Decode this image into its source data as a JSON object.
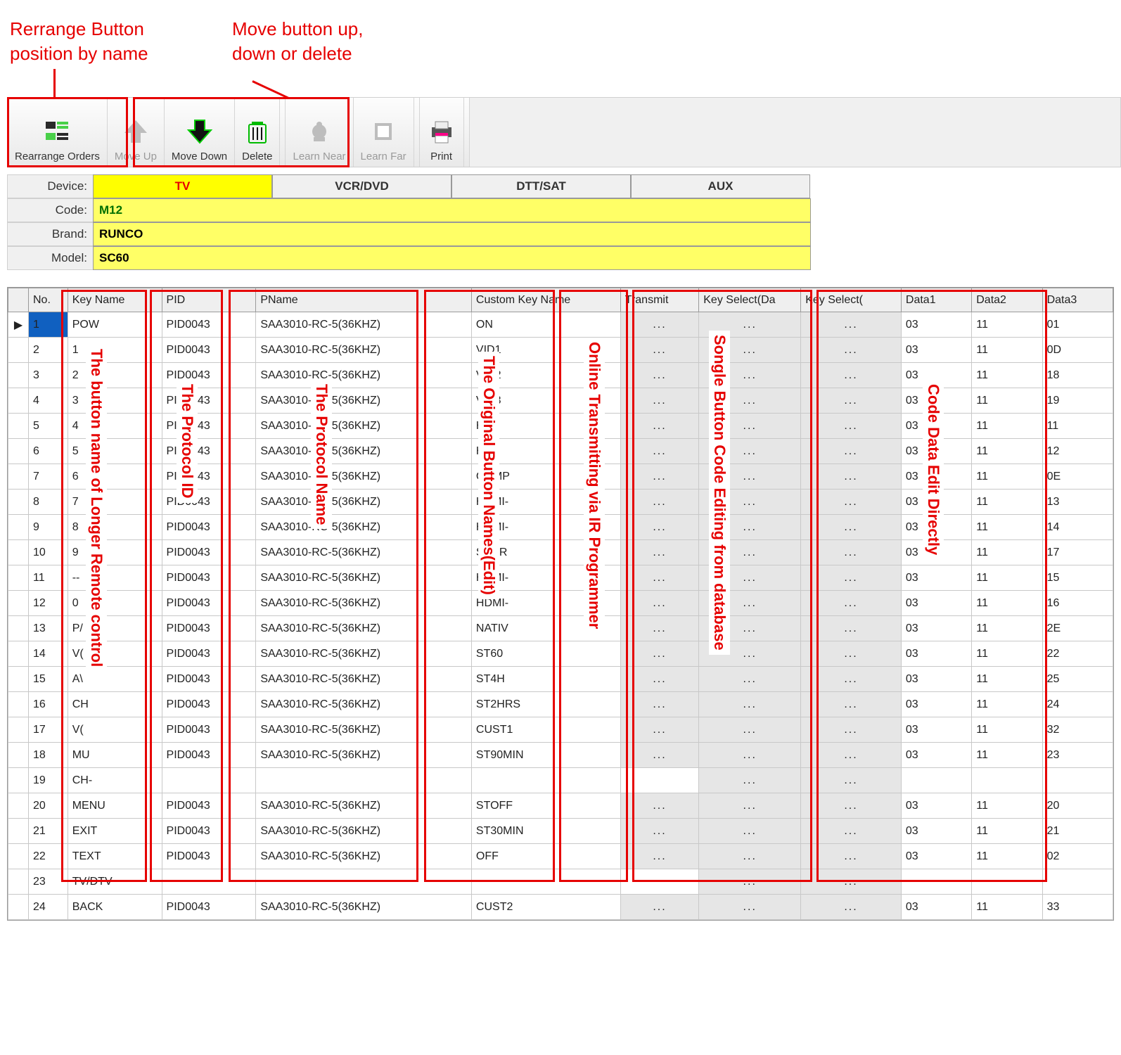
{
  "annotations": {
    "rearrange": "Rerrange Button\nposition by name",
    "move": "Move button up,\ndown or delete"
  },
  "overlay_labels": {
    "key_name": "The button name of Longer Remote control",
    "pid": "The Protocol ID",
    "pname": "The Protocol Name",
    "custom": "The Original Button Names(Edit)",
    "transmit": "Online Transmitting via IR Programmer",
    "keyselect": "Songle Button Code Editing from database",
    "data": "Code Data Edit Directly"
  },
  "toolbar": {
    "rearrange": "Rearrange Orders",
    "move_up": "Move Up",
    "move_down": "Move Down",
    "delete": "Delete",
    "learn_near": "Learn Near",
    "learn_far": "Learn Far",
    "print": "Print"
  },
  "device": {
    "labels": {
      "device": "Device:",
      "code": "Code:",
      "brand": "Brand:",
      "model": "Model:"
    },
    "tabs": [
      "TV",
      "VCR/DVD",
      "DTT/SAT",
      "AUX"
    ],
    "code": "M12",
    "brand": "RUNCO",
    "model": "SC60"
  },
  "grid": {
    "headers": {
      "no": "No.",
      "key": "Key Name",
      "pid": "PID",
      "pname": "PName",
      "ckn": "Custom Key Name",
      "tx": "Transmit",
      "ks1": "Key Select(Da",
      "ks2": "Key Select(",
      "d1": "Data1",
      "d2": "Data2",
      "d3": "Data3"
    },
    "rows": [
      {
        "no": "1",
        "key": "POW",
        "pid": "PID0043",
        "pname": "SAA3010-RC-5(36KHZ)",
        "ckn": "ON",
        "d1": "03",
        "d2": "11",
        "d3": "01"
      },
      {
        "no": "2",
        "key": "1",
        "pid": "PID0043",
        "pname": "SAA3010-RC-5(36KHZ)",
        "ckn": "VID1",
        "d1": "03",
        "d2": "11",
        "d3": "0D"
      },
      {
        "no": "3",
        "key": "2",
        "pid": "PID0043",
        "pname": "SAA3010-RC-5(36KHZ)",
        "ckn": "VID2",
        "d1": "03",
        "d2": "11",
        "d3": "18"
      },
      {
        "no": "4",
        "key": "3",
        "pid": "PID0043",
        "pname": "SAA3010-RC-5(36KHZ)",
        "ckn": "VID3",
        "d1": "03",
        "d2": "11",
        "d3": "19"
      },
      {
        "no": "5",
        "key": "4",
        "pid": "PID0043",
        "pname": "SAA3010-RC-5(36KHZ)",
        "ckn": "HD1",
        "d1": "03",
        "d2": "11",
        "d3": "11"
      },
      {
        "no": "6",
        "key": "5",
        "pid": "PID0043",
        "pname": "SAA3010-RC-5(36KHZ)",
        "ckn": "HD2",
        "d1": "03",
        "d2": "11",
        "d3": "12"
      },
      {
        "no": "7",
        "key": "6",
        "pid": "PID0043",
        "pname": "SAA3010-RC-5(36KHZ)",
        "ckn": "COMP",
        "d1": "03",
        "d2": "11",
        "d3": "0E"
      },
      {
        "no": "8",
        "key": "7",
        "pid": "PID0043",
        "pname": "SAA3010-RC-5(36KHZ)",
        "ckn": "HDMI-",
        "d1": "03",
        "d2": "11",
        "d3": "13"
      },
      {
        "no": "9",
        "key": "8",
        "pid": "PID0043",
        "pname": "SAA3010-RC-5(36KHZ)",
        "ckn": "HDMI-",
        "d1": "03",
        "d2": "11",
        "d3": "14"
      },
      {
        "no": "10",
        "key": "9",
        "pid": "PID0043",
        "pname": "SAA3010-RC-5(36KHZ)",
        "ckn": "SCAR",
        "d1": "03",
        "d2": "11",
        "d3": "17"
      },
      {
        "no": "11",
        "key": "--",
        "pid": "PID0043",
        "pname": "SAA3010-RC-5(36KHZ)",
        "ckn": "HDMI-",
        "d1": "03",
        "d2": "11",
        "d3": "15"
      },
      {
        "no": "12",
        "key": "0",
        "pid": "PID0043",
        "pname": "SAA3010-RC-5(36KHZ)",
        "ckn": "HDMI-",
        "d1": "03",
        "d2": "11",
        "d3": "16"
      },
      {
        "no": "13",
        "key": "P/",
        "pid": "PID0043",
        "pname": "SAA3010-RC-5(36KHZ)",
        "ckn": "NATIV",
        "d1": "03",
        "d2": "11",
        "d3": "2E"
      },
      {
        "no": "14",
        "key": "V(",
        "pid": "PID0043",
        "pname": "SAA3010-RC-5(36KHZ)",
        "ckn": "ST60",
        "d1": "03",
        "d2": "11",
        "d3": "22"
      },
      {
        "no": "15",
        "key": "A\\",
        "pid": "PID0043",
        "pname": "SAA3010-RC-5(36KHZ)",
        "ckn": "ST4H",
        "d1": "03",
        "d2": "11",
        "d3": "25"
      },
      {
        "no": "16",
        "key": "CH",
        "pid": "PID0043",
        "pname": "SAA3010-RC-5(36KHZ)",
        "ckn": "ST2HRS",
        "d1": "03",
        "d2": "11",
        "d3": "24"
      },
      {
        "no": "17",
        "key": "V(",
        "pid": "PID0043",
        "pname": "SAA3010-RC-5(36KHZ)",
        "ckn": "CUST1",
        "d1": "03",
        "d2": "11",
        "d3": "32"
      },
      {
        "no": "18",
        "key": "MU",
        "pid": "PID0043",
        "pname": "SAA3010-RC-5(36KHZ)",
        "ckn": "ST90MIN",
        "d1": "03",
        "d2": "11",
        "d3": "23"
      },
      {
        "no": "19",
        "key": "CH-",
        "pid": "",
        "pname": "",
        "ckn": "",
        "d1": "",
        "d2": "",
        "d3": "",
        "no_tx": true
      },
      {
        "no": "20",
        "key": "MENU",
        "pid": "PID0043",
        "pname": "SAA3010-RC-5(36KHZ)",
        "ckn": "STOFF",
        "d1": "03",
        "d2": "11",
        "d3": "20"
      },
      {
        "no": "21",
        "key": "EXIT",
        "pid": "PID0043",
        "pname": "SAA3010-RC-5(36KHZ)",
        "ckn": "ST30MIN",
        "d1": "03",
        "d2": "11",
        "d3": "21"
      },
      {
        "no": "22",
        "key": "TEXT",
        "pid": "PID0043",
        "pname": "SAA3010-RC-5(36KHZ)",
        "ckn": "OFF",
        "d1": "03",
        "d2": "11",
        "d3": "02"
      },
      {
        "no": "23",
        "key": "TV/DTV",
        "pid": "",
        "pname": "",
        "ckn": "",
        "d1": "",
        "d2": "",
        "d3": "",
        "no_tx": true
      },
      {
        "no": "24",
        "key": "BACK",
        "pid": "PID0043",
        "pname": "SAA3010-RC-5(36KHZ)",
        "ckn": "CUST2",
        "d1": "03",
        "d2": "11",
        "d3": "33"
      }
    ]
  }
}
